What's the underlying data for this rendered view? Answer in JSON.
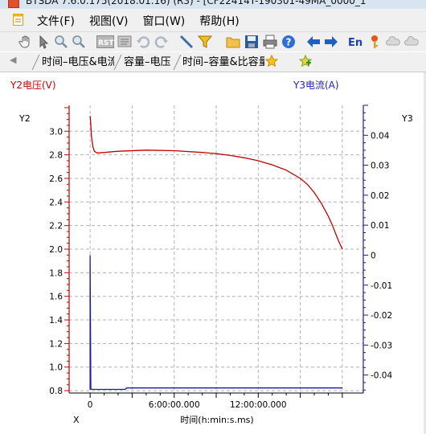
{
  "window": {
    "title": "BTSDA 7.6.0.175(2018.01.16)  (R3)  - [CF22414T-190301-49MA_0000_1"
  },
  "menu": {
    "items": [
      "文件(F)",
      "视图(V)",
      "窗口(W)",
      "帮助(H)"
    ]
  },
  "toolbar": {
    "icons": [
      "hand-icon",
      "pointer-icon",
      "zoom-in-icon",
      "zoom-out-icon",
      "rst-icon",
      "map-icon",
      "undo-icon",
      "redo-icon",
      "line-icon",
      "filter-icon",
      "open-folder-icon",
      "save-icon",
      "print-icon",
      "help-icon",
      "back-arrow-icon",
      "forward-arrow-icon",
      "language-en-icon",
      "key-icon",
      "cloud-icon-1",
      "cloud-icon-2"
    ]
  },
  "tabs": {
    "items": [
      "时间–电压&电流",
      "容量–电压",
      "时间–容量&比容量"
    ],
    "active_index": 0
  },
  "colors": {
    "voltage": "#c00000",
    "current": "#1a1aa6",
    "grid": "#b4b4b4"
  },
  "chart": {
    "y2_header": "Y2电压(V)",
    "y3_header": "Y3电流(A)",
    "y2_label": "Y2",
    "y3_label": "Y3",
    "x_label": "X",
    "x_title": "时间(h:min:s.ms)"
  },
  "chart_data": {
    "type": "line",
    "x_ticks": [
      "0",
      "6:00:00.000",
      "12:00:00.000"
    ],
    "x_range_hours": [
      -1.5,
      19.5
    ],
    "y2_ticks": [
      "0.8",
      "1.0",
      "1.2",
      "1.4",
      "1.6",
      "1.8",
      "2.0",
      "2.2",
      "2.4",
      "2.6",
      "2.8",
      "3.0"
    ],
    "y2_range": [
      0.78,
      3.22
    ],
    "y3_ticks": [
      "-0.04",
      "-0.03",
      "-0.02",
      "-0.01",
      "0",
      "0.01",
      "0.02",
      "0.03",
      "0.04"
    ],
    "y3_range": [
      -0.046,
      0.05
    ],
    "grid": true,
    "series": [
      {
        "axis": "Y2",
        "x_hours": [
          0.0,
          0.05,
          0.1,
          0.2,
          0.3,
          0.5,
          1.0,
          2.0,
          4.0,
          6.0,
          8.0,
          9.0,
          10.0,
          11.0,
          12.0,
          13.0,
          14.0,
          15.0,
          15.5,
          16.0,
          16.5,
          17.0,
          17.3,
          17.5,
          17.7,
          17.85,
          18.0
        ],
        "values": [
          3.13,
          3.05,
          2.95,
          2.87,
          2.83,
          2.815,
          2.82,
          2.83,
          2.84,
          2.835,
          2.82,
          2.81,
          2.795,
          2.775,
          2.75,
          2.715,
          2.67,
          2.6,
          2.55,
          2.48,
          2.39,
          2.28,
          2.2,
          2.14,
          2.08,
          2.04,
          2.0
        ]
      },
      {
        "axis": "Y3",
        "x_hours": [
          0.0,
          0.0,
          0.05,
          0.1,
          2.5,
          2.6,
          18.0
        ],
        "values": [
          -0.045,
          0.0,
          -0.0445,
          -0.0448,
          -0.0448,
          -0.0443,
          -0.0443
        ]
      }
    ]
  }
}
